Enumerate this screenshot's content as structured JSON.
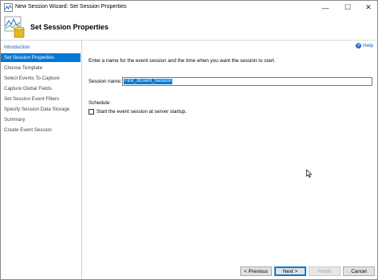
{
  "window": {
    "title": "New Session Wizard: Set Session Properties",
    "minimize_glyph": "—",
    "maximize_glyph": "☐",
    "close_glyph": "✕"
  },
  "header": {
    "title": "Set Session Properties"
  },
  "sidebar": {
    "items": [
      {
        "label": "Introduction"
      },
      {
        "label": "Set Session Properties"
      },
      {
        "label": "Choose Template"
      },
      {
        "label": "Select Events To Capture"
      },
      {
        "label": "Capture Global Fields"
      },
      {
        "label": "Set Session Event Filters"
      },
      {
        "label": "Specify Session Data Storage"
      },
      {
        "label": "Summary"
      },
      {
        "label": "Create Event Session"
      }
    ],
    "selected_index": 1
  },
  "help": {
    "label": "Help",
    "icon": "?"
  },
  "main": {
    "instruction": "Enter a name for the event session and the time when you want the session to start.",
    "session_name_label": "Session name:",
    "session_name_value": "First_XEvent_Session",
    "schedule_label": "Schedule:",
    "start_checkbox_label": "Start the event session at server startup.",
    "start_checkbox_checked": false
  },
  "footer": {
    "previous_label": "< Previous",
    "next_label": "Next >",
    "finish_label": "Finish",
    "cancel_label": "Cancel"
  },
  "colors": {
    "accent": "#0078d7",
    "link": "#1a5fb4"
  }
}
